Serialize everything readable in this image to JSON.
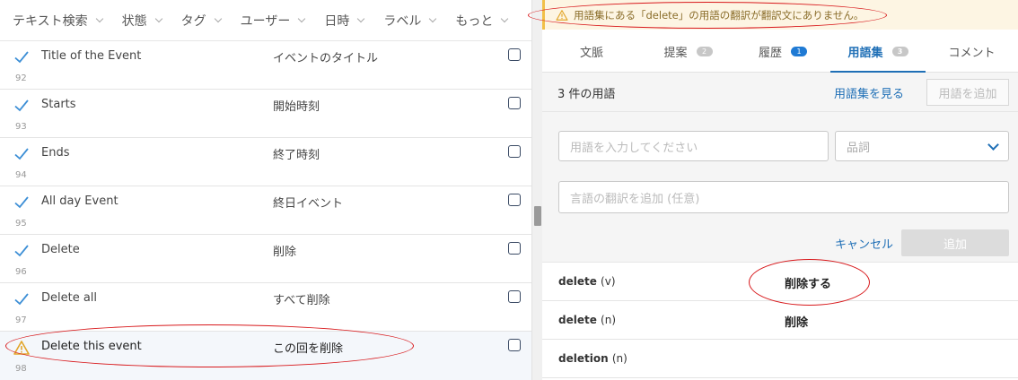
{
  "filters": [
    {
      "label": "テキスト検索"
    },
    {
      "label": "状態"
    },
    {
      "label": "タグ"
    },
    {
      "label": "ユーザー"
    },
    {
      "label": "日時"
    },
    {
      "label": "ラベル"
    },
    {
      "label": "もっと"
    }
  ],
  "strings": [
    {
      "source": "Title of the Event",
      "translation": "イベントのタイトル",
      "number": "92",
      "status": "approved"
    },
    {
      "source": "Starts",
      "translation": "開始時刻",
      "number": "93",
      "status": "approved"
    },
    {
      "source": "Ends",
      "translation": "終了時刻",
      "number": "94",
      "status": "approved"
    },
    {
      "source": "All day Event",
      "translation": "終日イベント",
      "number": "95",
      "status": "approved"
    },
    {
      "source": "Delete",
      "translation": "削除",
      "number": "96",
      "status": "approved"
    },
    {
      "source": "Delete all",
      "translation": "すべて削除",
      "number": "97",
      "status": "approved"
    },
    {
      "source": "Delete this event",
      "translation": "この回を削除",
      "number": "98",
      "status": "warning"
    }
  ],
  "warning": {
    "text": "用語集にある「delete」の用語の翻訳が翻訳文にありません。"
  },
  "tabs": [
    {
      "label": "文脈",
      "badge": ""
    },
    {
      "label": "提案",
      "badge": "2"
    },
    {
      "label": "履歴",
      "badge": "1"
    },
    {
      "label": "用語集",
      "badge": "3"
    },
    {
      "label": "コメント",
      "badge": ""
    }
  ],
  "glossary": {
    "count_label": "3 件の用語",
    "view_link": "用語集を見る",
    "add_term_button": "用語を追加",
    "term_placeholder": "用語を入力してください",
    "pos_placeholder": "品詞",
    "translation_placeholder": "言語の翻訳を追加 (任意)",
    "cancel_label": "キャンセル",
    "add_label": "追加",
    "terms": [
      {
        "term": "delete",
        "pos": "(v)",
        "translation": "削除する"
      },
      {
        "term": "delete",
        "pos": "(n)",
        "translation": "削除"
      },
      {
        "term": "deletion",
        "pos": "(n)",
        "translation": ""
      }
    ]
  },
  "colors": {
    "accent": "#1f6fb6",
    "approved_check": "#3d8fd6",
    "warning": "#f1c049",
    "annotation": "#d8191c"
  },
  "icons": {
    "approved": "check-icon",
    "warning": "warning-icon",
    "dropdown": "chevron-down-icon",
    "checkbox": "checkbox-icon"
  }
}
